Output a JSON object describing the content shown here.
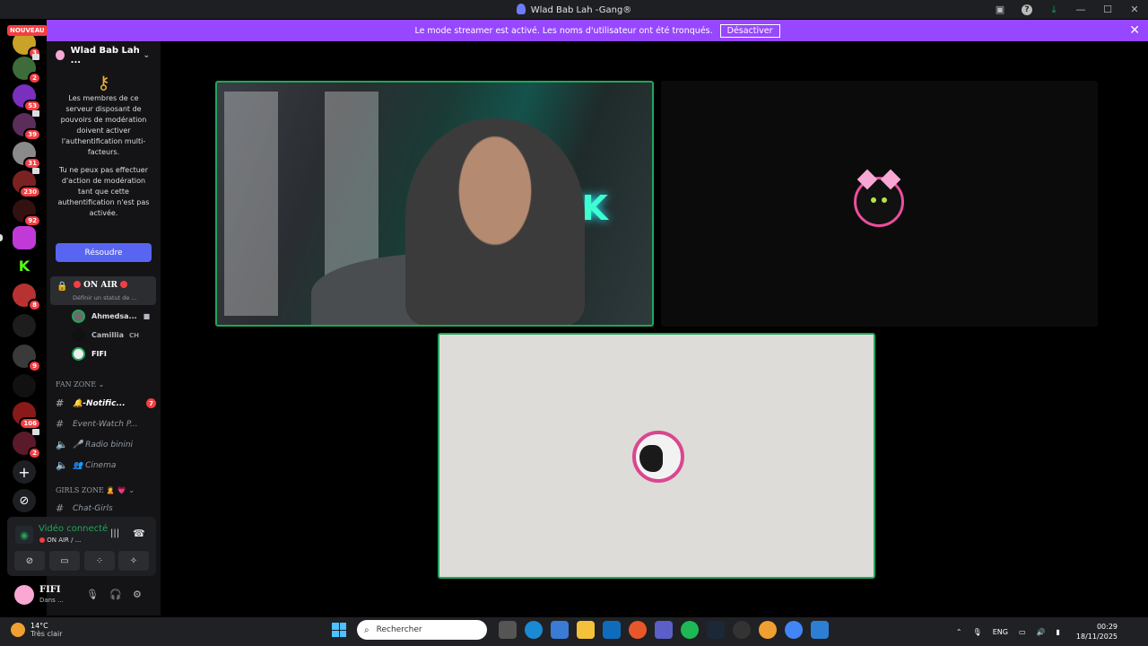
{
  "window": {
    "title": "Wlad Bab Lah -Gang®"
  },
  "banner": {
    "message": "Le mode streamer est activé. Les noms d'utilisateur ont été tronqués.",
    "button": "Désactiver",
    "close": "✕"
  },
  "guilds": {
    "new_label": "NOUVEAU",
    "badges": [
      "3",
      "2",
      "53",
      "39",
      "31",
      "230",
      "92",
      "8",
      "9",
      "106",
      "2"
    ]
  },
  "server": {
    "name": "Wlad Bab Lah ...",
    "chevron": "⌄"
  },
  "mfa_notice": {
    "p1": "Les membres de ce serveur disposant de pouvoirs de modération doivent activer l'authentification multi-facteurs.",
    "p2": "Tu ne peux pas effectuer d'action de modération tant que cette authentification n'est pas activée.",
    "button": "Résoudre"
  },
  "voice_channel": {
    "name": "ON AIR",
    "status": "Définir un statut de ...",
    "users": [
      {
        "name": "Ahmedsa..."
      },
      {
        "name": "Camillia",
        "extra": "CH"
      },
      {
        "name": "FIFI"
      }
    ]
  },
  "categories": [
    {
      "name": "FAN ZONE",
      "channels": [
        {
          "icon": "#",
          "label": "🔔-Notific...",
          "count": "7",
          "unread": true
        },
        {
          "icon": "#",
          "label": "Event-Watch P..."
        },
        {
          "icon": "🔈",
          "label": "🎤 Radio binini"
        },
        {
          "icon": "🔈",
          "label": "👥 Cinema"
        }
      ]
    },
    {
      "name": "GIRLS ZONE 🙎 💗",
      "channels": [
        {
          "icon": "#",
          "label": "Chat-Girls"
        }
      ]
    }
  ],
  "voice_panel": {
    "status": "Vidéo connecté",
    "channel": "ON AIR / ..."
  },
  "user": {
    "name": "FIFI",
    "status": "Dans ..."
  },
  "taskbar": {
    "temperature": "14°C",
    "weather": "Très clair",
    "search_placeholder": "Rechercher",
    "lang": "ENG",
    "time": "00:29",
    "date": "18/11/2025"
  },
  "colors": {
    "banner": "#9747ff",
    "speaking": "#23a55a",
    "blurple": "#5865f2",
    "badge": "#f23f43"
  }
}
